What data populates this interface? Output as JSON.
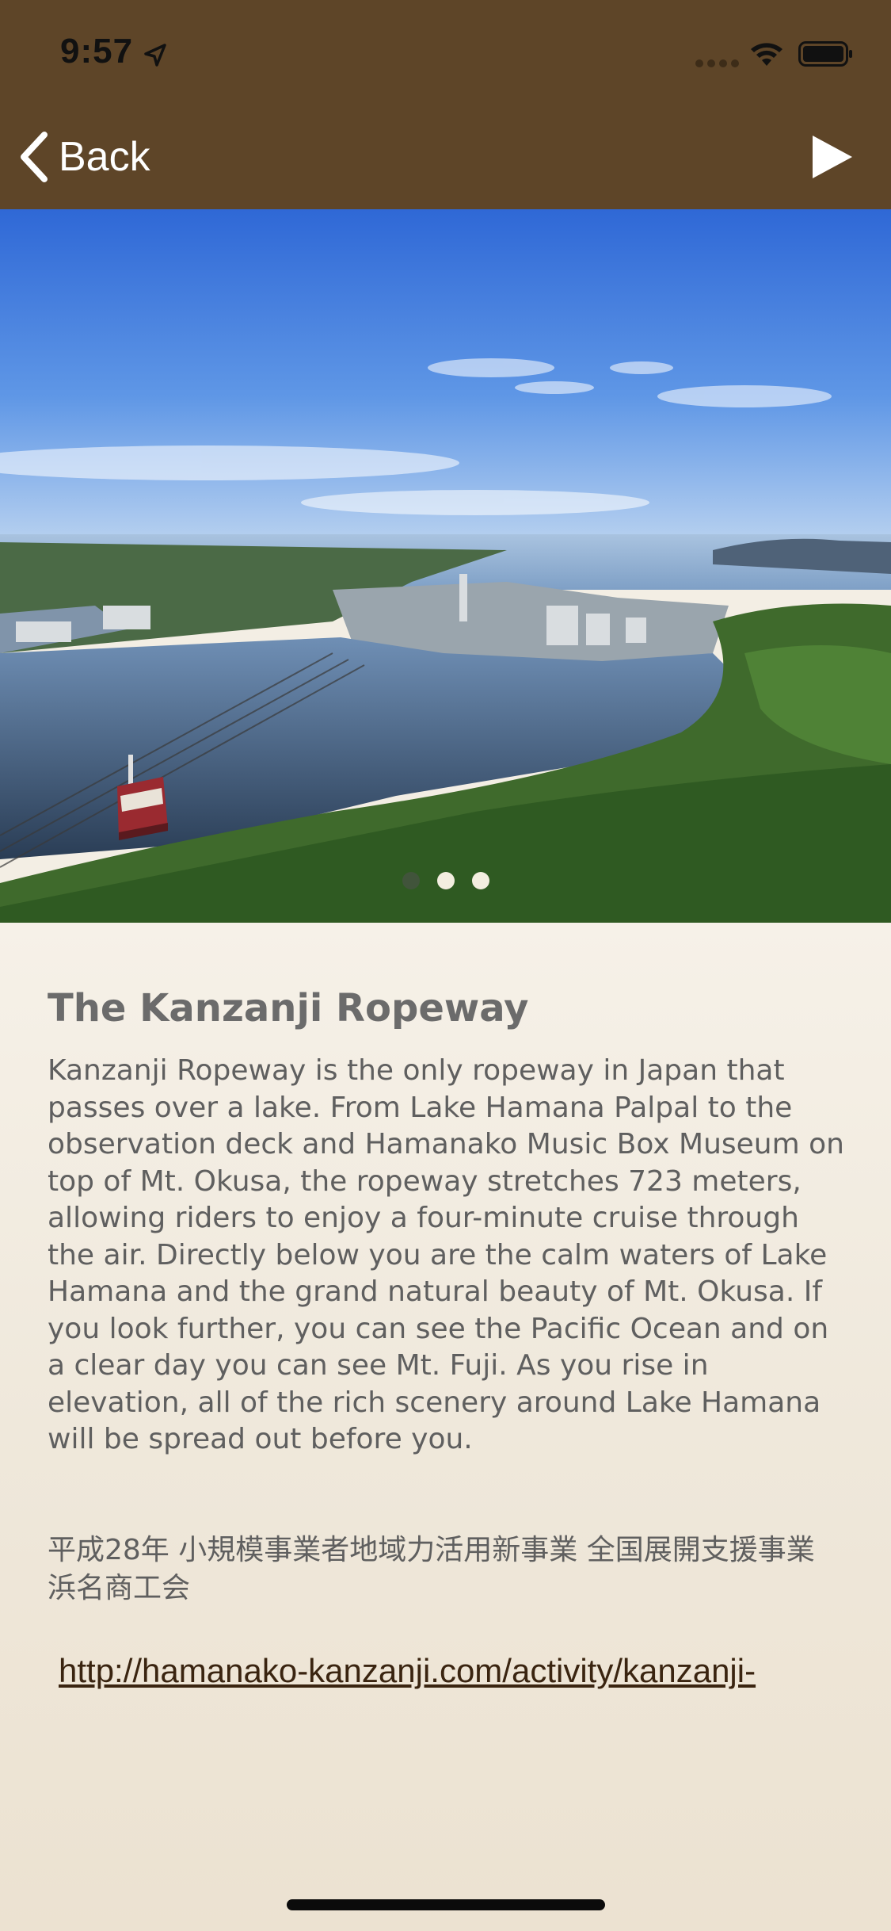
{
  "status_bar": {
    "time": "9:57",
    "icons": [
      "location-arrow-icon",
      "cellular-signal-icon",
      "wifi-icon",
      "battery-icon"
    ]
  },
  "nav": {
    "back_label": "Back",
    "back_icon": "chevron-left-icon",
    "play_icon": "play-icon"
  },
  "carousel": {
    "page_count": 3,
    "active_index": 0
  },
  "article": {
    "title": "The Kanzanji Ropeway",
    "body": "Kanzanji Ropeway is the only ropeway in Japan that passes over a lake. From Lake Hamana Palpal to the observation deck and Hamanako Music Box Museum on top of Mt. Okusa, the ropeway stretches 723 meters, allowing riders to enjoy a four-minute cruise through the air. Directly below you are the calm waters of Lake Hamana and the grand natural beauty of Mt. Okusa. If you look further, you can see the Pacific Ocean and on a clear day you can see Mt. Fuji. As you rise in elevation, all of the rich scenery around Lake Hamana will be spread out before you.",
    "credit": "平成28年 小規模事業者地域力活用新事業 全国展開支援事業 浜名商工会",
    "link_text": "http://hamanako-kanzanji.com/activity/kanzanji-"
  },
  "colors": {
    "header_bg": "#5e4528",
    "content_bg": "#f3eee4",
    "title_text": "#6b6b6b",
    "body_text": "#5f5f5f",
    "link_text": "#3a2410"
  }
}
